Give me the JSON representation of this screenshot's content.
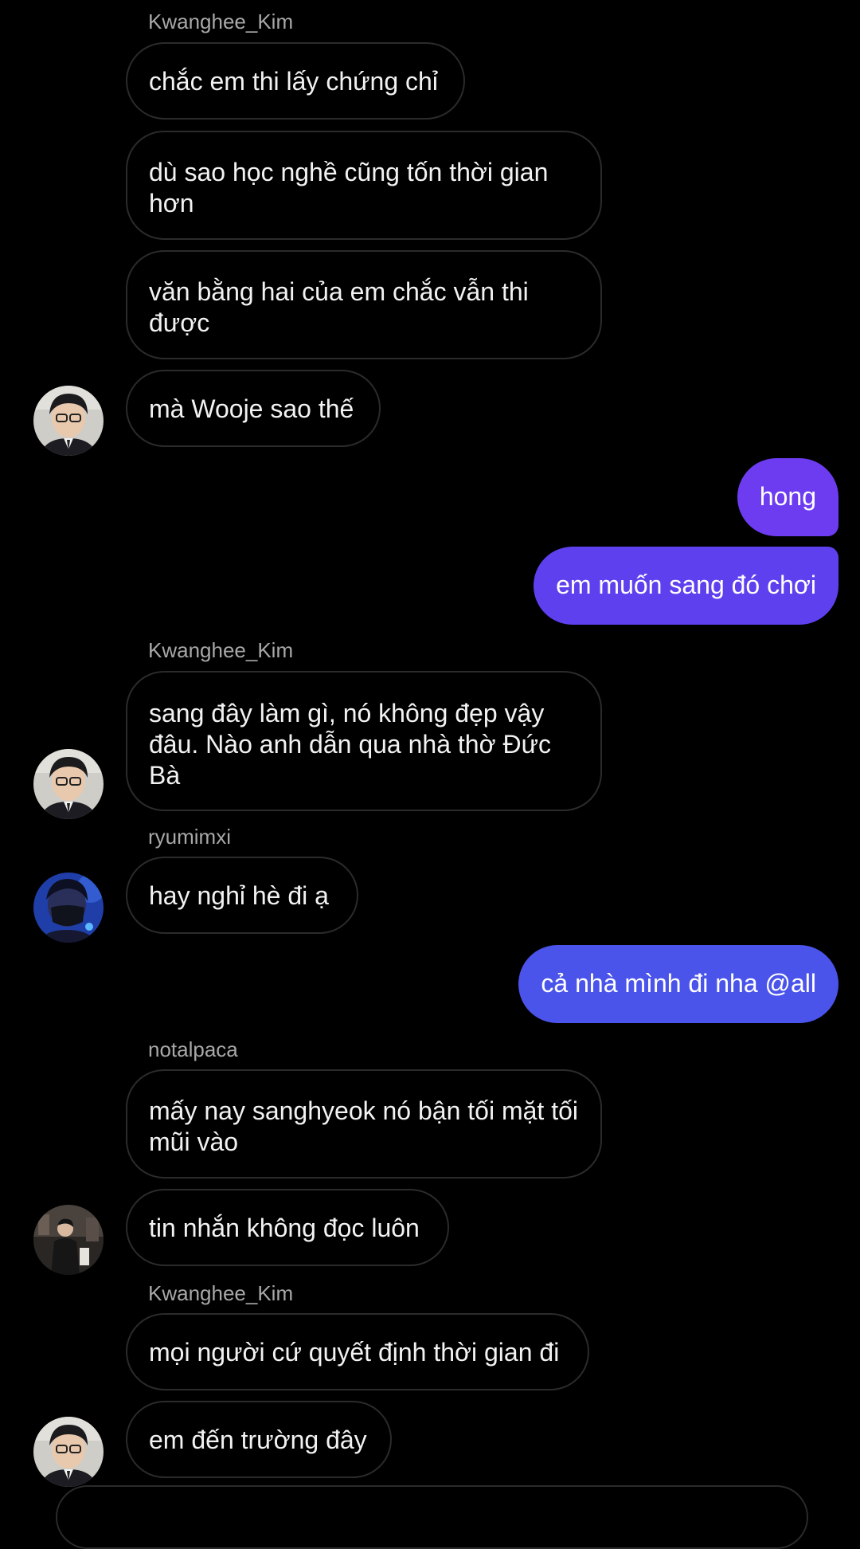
{
  "colors": {
    "background": "#000000",
    "incoming_border": "#2b2b2b",
    "sender_name": "#a8a8a8",
    "outgoing_purple": "#6d3cf0",
    "outgoing_violet": "#5a45ee",
    "outgoing_blue": "#4a54ea"
  },
  "messages": [
    {
      "type": "sender",
      "name": "Kwanghee_Kim"
    },
    {
      "type": "in",
      "text": "chắc em thi lấy chứng chỉ"
    },
    {
      "type": "in",
      "text": "dù sao học nghề cũng tốn thời gian hơn"
    },
    {
      "type": "in",
      "text": "văn bằng hai của em chắc vẫn thi được"
    },
    {
      "type": "in",
      "text": "mà Wooje sao thế",
      "avatar": "kwanghee-avatar"
    },
    {
      "type": "out",
      "text": "hong"
    },
    {
      "type": "out",
      "text": "em muốn sang đó chơi"
    },
    {
      "type": "sender",
      "name": "Kwanghee_Kim"
    },
    {
      "type": "in",
      "text": "sang đây làm gì, nó không đẹp vậy đâu. Nào anh dẫn qua nhà thờ Đức Bà",
      "avatar": "kwanghee-avatar"
    },
    {
      "type": "sender",
      "name": "ryumimxi"
    },
    {
      "type": "in",
      "text": "hay nghỉ hè đi ạ",
      "avatar": "ryumimxi-avatar"
    },
    {
      "type": "out",
      "text": "cả nhà mình đi nha @all"
    },
    {
      "type": "sender",
      "name": "notalpaca"
    },
    {
      "type": "in",
      "text": "mấy nay sanghyeok nó bận tối mặt tối mũi vào"
    },
    {
      "type": "in",
      "text": "tin nhắn không đọc luôn",
      "avatar": "notalpaca-avatar"
    },
    {
      "type": "sender",
      "name": "Kwanghee_Kim"
    },
    {
      "type": "in",
      "text": "mọi người cứ quyết định thời gian đi"
    },
    {
      "type": "in",
      "text": "em đến trường đây",
      "avatar": "kwanghee-avatar"
    }
  ]
}
